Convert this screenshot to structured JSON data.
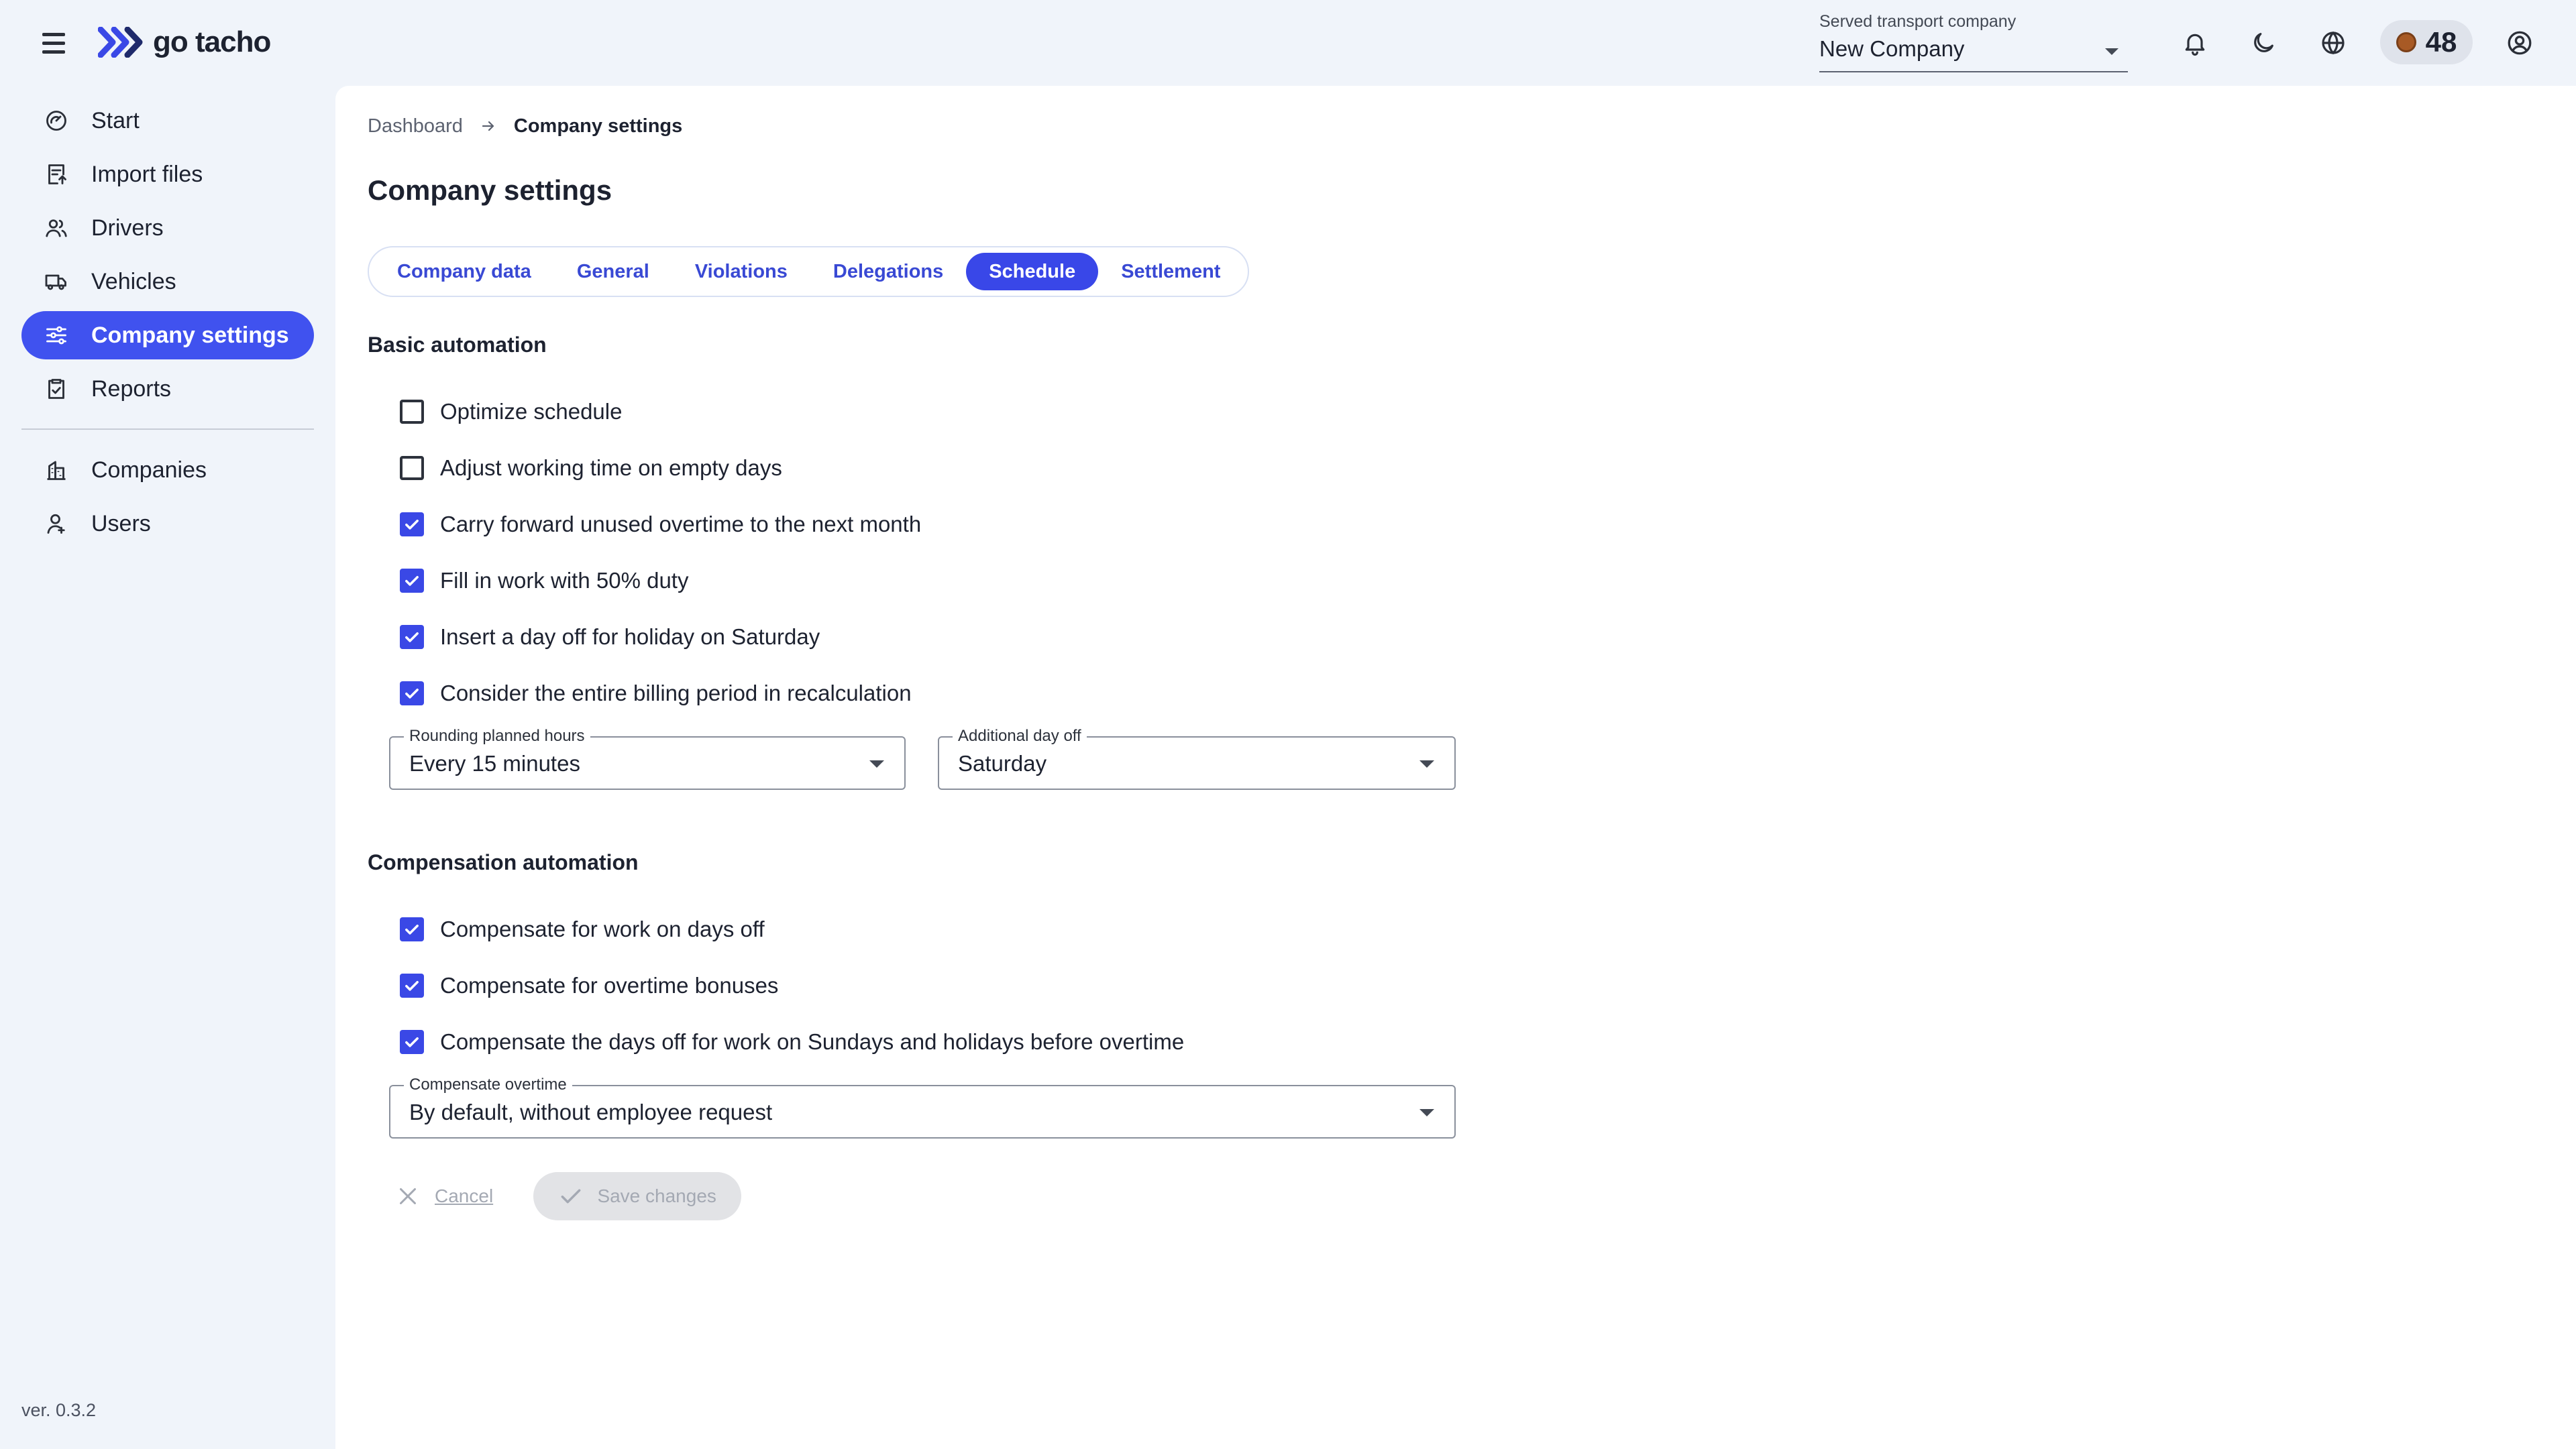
{
  "app": {
    "name": "go tacho"
  },
  "header": {
    "company_select": {
      "label": "Served transport company",
      "value": "New Company"
    },
    "credits": "48"
  },
  "sidebar": {
    "items": [
      {
        "label": "Start",
        "icon": "gauge-icon"
      },
      {
        "label": "Import files",
        "icon": "import-file-icon"
      },
      {
        "label": "Drivers",
        "icon": "people-icon"
      },
      {
        "label": "Vehicles",
        "icon": "truck-icon"
      },
      {
        "label": "Company settings",
        "icon": "sliders-icon",
        "active": true
      },
      {
        "label": "Reports",
        "icon": "clipboard-icon"
      },
      {
        "label": "Companies",
        "icon": "building-icon"
      },
      {
        "label": "Users",
        "icon": "user-icon"
      }
    ],
    "version": "ver. 0.3.2"
  },
  "breadcrumb": {
    "parent": "Dashboard",
    "current": "Company settings"
  },
  "page_title": "Company settings",
  "tabs": [
    "Company data",
    "General",
    "Violations",
    "Delegations",
    "Schedule",
    "Settlement"
  ],
  "active_tab": "Schedule",
  "basic": {
    "title": "Basic automation",
    "options": [
      {
        "label": "Optimize schedule",
        "checked": false
      },
      {
        "label": "Adjust working time on empty days",
        "checked": false
      },
      {
        "label": "Carry forward unused overtime to the next month",
        "checked": true
      },
      {
        "label": "Fill in work with 50% duty",
        "checked": true
      },
      {
        "label": "Insert a day off for holiday on Saturday",
        "checked": true
      },
      {
        "label": "Consider the entire billing period in recalculation",
        "checked": true
      }
    ],
    "rounding": {
      "label": "Rounding planned hours",
      "value": "Every 15 minutes"
    },
    "day_off": {
      "label": "Additional day off",
      "value": "Saturday"
    }
  },
  "compensation": {
    "title": "Compensation automation",
    "options": [
      {
        "label": "Compensate for work on days off",
        "checked": true
      },
      {
        "label": "Compensate for overtime bonuses",
        "checked": true
      },
      {
        "label": "Compensate the days off for work on Sundays and holidays before overtime",
        "checked": true
      }
    ],
    "overtime": {
      "label": "Compensate overtime",
      "value": "By default, without employee request"
    }
  },
  "actions": {
    "cancel": "Cancel",
    "save": "Save changes"
  },
  "colors": {
    "accent": "#4052ef",
    "checkbox": "#3a48e6",
    "sidebar_bg": "#f0f4fa"
  }
}
